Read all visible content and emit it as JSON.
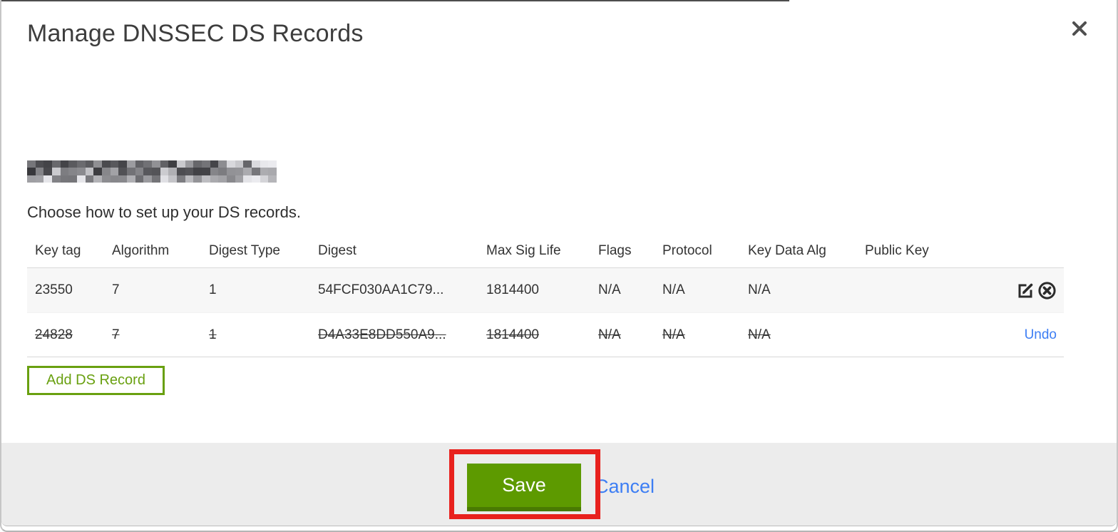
{
  "modal": {
    "title": "Manage DNSSEC DS Records",
    "subtitle": "Choose how to set up your DS records.",
    "domain_obscured": true
  },
  "table": {
    "columns": [
      "Key tag",
      "Algorithm",
      "Digest Type",
      "Digest",
      "Max Sig Life",
      "Flags",
      "Protocol",
      "Key Data Alg",
      "Public Key"
    ],
    "rows": [
      {
        "key_tag": "23550",
        "algorithm": "7",
        "digest_type": "1",
        "digest": "54FCF030AA1C79...",
        "max_sig_life": "1814400",
        "flags": "N/A",
        "protocol": "N/A",
        "key_data_alg": "N/A",
        "public_key": "",
        "state": "normal"
      },
      {
        "key_tag": "24828",
        "algorithm": "7",
        "digest_type": "1",
        "digest": "D4A33E8DD550A9...",
        "max_sig_life": "1814400",
        "flags": "N/A",
        "protocol": "N/A",
        "key_data_alg": "N/A",
        "public_key": "",
        "state": "marked-for-deletion",
        "undo_label": "Undo"
      }
    ]
  },
  "buttons": {
    "add_ds_record": "Add DS Record",
    "save": "Save",
    "cancel": "Cancel"
  },
  "colors": {
    "accent_green": "#5d9a00",
    "accent_green_dark": "#497a02",
    "outline_green": "#69a010",
    "link_blue": "#3d7ef4",
    "annotation_red": "#e8211d",
    "footer_gray": "#ececec"
  }
}
